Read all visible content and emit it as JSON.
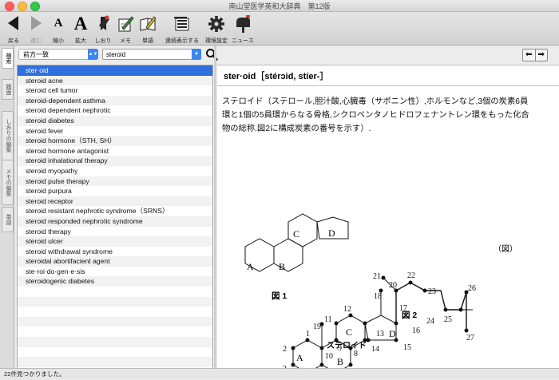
{
  "window": {
    "title": "南山堂医学英和大辞典　第12版"
  },
  "toolbar": {
    "back": "戻る",
    "forward": "進む",
    "shrink": "縮小",
    "enlarge": "拡大",
    "bookmark": "しおり",
    "memo": "メモ",
    "wordbook": "単語",
    "continuous": "連続表示する",
    "settings": "環境設定",
    "news": "ニュース",
    "glyph_small": "A",
    "glyph_large": "A"
  },
  "sidetabs": [
    "検索",
    "履歴",
    "しおりの編集",
    "メモの編集",
    "単語"
  ],
  "search": {
    "mode": "前方一致",
    "query": "steroid"
  },
  "results": [
    "ster·oid",
    "steroid acne",
    "steroid cell tumor",
    "steroid-dependent asthma",
    "steroid dependent nephrotic",
    "steroid diabetes",
    "steroid fever",
    "steroid hormone（STH, SH）",
    "steroid hormone antagonist",
    "steroid inhalational therapy",
    "steroid myopathy",
    "steroid pulse therapy",
    "steroid purpura",
    "steroid receptor",
    "steroid resistant nephrotic syndrome（SRNS）",
    "steroid responded nephrotic syndrome",
    "steroid therapy",
    "steroid ulcer",
    "steroid withdrawal syndrome",
    "steroidal abortifacient agent",
    "ste·roi·do·gen·e·sis",
    "steroidogenic diabetes"
  ],
  "entry": {
    "headword": "ster·oid［stérɔid, stíer-］",
    "definition_line1": "ステロイド（ステロール,胆汁酸,心臓毒（サポニン性）,ホルモンなど,3個の炭素6員",
    "definition_line2": "環と1個の5員環からなる骨格,シクロペンタノヒドロフェナントレン環をもった化合",
    "definition_line3": "物の総称.図2に構成炭素の番号を示す）."
  },
  "figure": {
    "ring_labels": [
      "A",
      "B",
      "C",
      "D"
    ],
    "fig1_caption": "図 1",
    "fig2_caption": "図 2",
    "fig_marker": "（図）",
    "compound_name": "ステロイド",
    "carbon_numbers": [
      "1",
      "2",
      "3",
      "4",
      "5",
      "6",
      "7",
      "8",
      "9",
      "10",
      "11",
      "12",
      "13",
      "14",
      "15",
      "16",
      "17",
      "18",
      "19",
      "20",
      "21",
      "22",
      "23",
      "24",
      "25",
      "26",
      "27"
    ]
  },
  "status": {
    "text": "22件見つかりました。"
  }
}
